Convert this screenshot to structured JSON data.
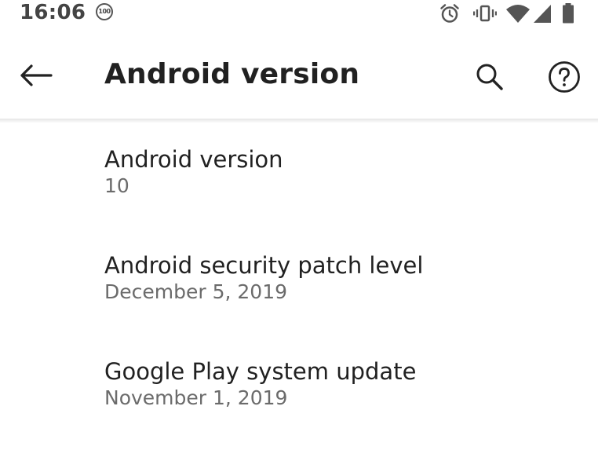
{
  "status_bar": {
    "time": "16:06",
    "notification_badge": "100",
    "icons": [
      "alarm-icon",
      "vibrate-icon",
      "wifi-icon",
      "cell-signal-icon",
      "battery-icon"
    ]
  },
  "app_bar": {
    "title": "Android version",
    "back_icon": "arrow-back-icon",
    "search_icon": "search-icon",
    "help_icon": "help-icon"
  },
  "preferences": [
    {
      "title": "Android version",
      "summary": "10"
    },
    {
      "title": "Android security patch level",
      "summary": "December 5, 2019"
    },
    {
      "title": "Google Play system update",
      "summary": "November 1, 2019"
    }
  ],
  "colors": {
    "title_text": "#212121",
    "summary_text": "#6b6b6b",
    "status_icons": "#555555"
  }
}
